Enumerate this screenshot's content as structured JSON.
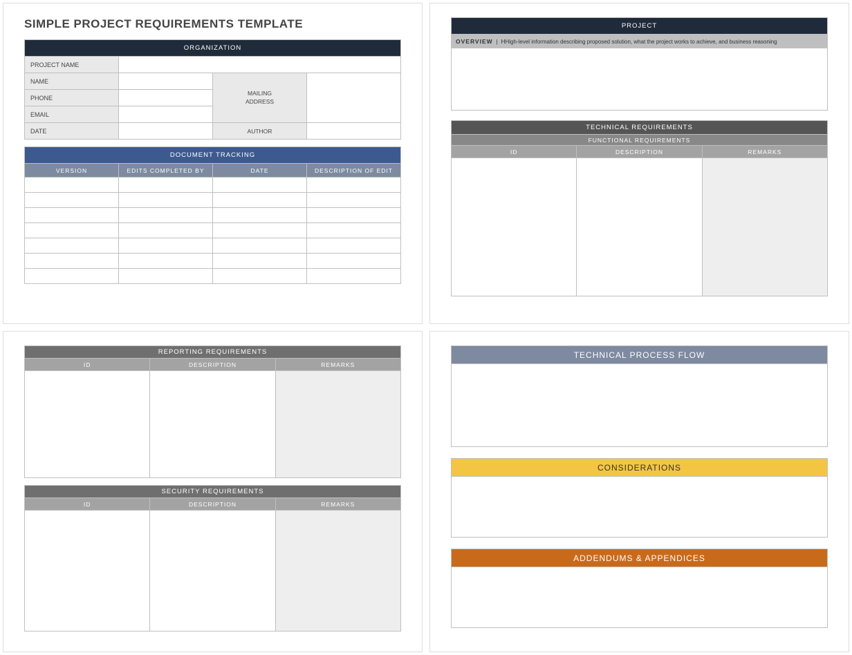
{
  "page_title": "SIMPLE PROJECT REQUIREMENTS TEMPLATE",
  "organization": {
    "header": "ORGANIZATION",
    "labels": {
      "project_name": "PROJECT NAME",
      "name": "NAME",
      "phone": "PHONE",
      "email": "EMAIL",
      "date": "DATE",
      "mailing_address": "MAILING ADDRESS",
      "author": "AUTHOR"
    }
  },
  "document_tracking": {
    "header": "DOCUMENT TRACKING",
    "cols": {
      "version": "VERSION",
      "edits_by": "EDITS COMPLETED BY",
      "date": "DATE",
      "desc": "DESCRIPTION OF EDIT"
    }
  },
  "project": {
    "header": "PROJECT",
    "overview_label": "OVERVIEW",
    "overview_hint": "High-level information describing proposed solution, what the project works to achieve, and business reasoning"
  },
  "tech_req": {
    "header": "TECHNICAL REQUIREMENTS",
    "sub_header": "FUNCTIONAL REQUIREMENTS",
    "cols": {
      "id": "ID",
      "desc": "DESCRIPTION",
      "remarks": "REMARKS"
    }
  },
  "reporting": {
    "header": "REPORTING REQUIREMENTS",
    "cols": {
      "id": "ID",
      "desc": "DESCRIPTION",
      "remarks": "REMARKS"
    }
  },
  "security": {
    "header": "SECURITY REQUIREMENTS",
    "cols": {
      "id": "ID",
      "desc": "DESCRIPTION",
      "remarks": "REMARKS"
    }
  },
  "flow": {
    "header": "TECHNICAL PROCESS FLOW"
  },
  "considerations": {
    "header": "CONSIDERATIONS"
  },
  "addendums": {
    "header": "ADDENDUMS & APPENDICES"
  }
}
